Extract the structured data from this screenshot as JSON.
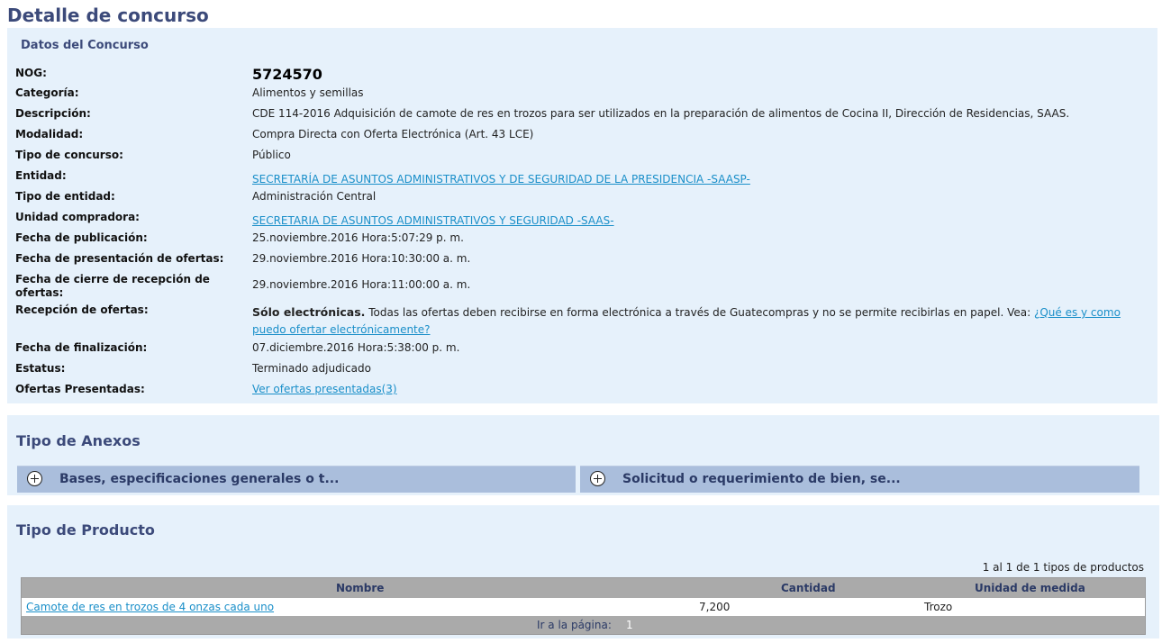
{
  "page": {
    "title": "Detalle de concurso"
  },
  "datos": {
    "section_title": "Datos del Concurso",
    "fields": {
      "nog": {
        "label": "NOG:",
        "value": "5724570"
      },
      "categoria": {
        "label": "Categoría:",
        "value": "Alimentos y semillas"
      },
      "descripcion": {
        "label": "Descripción:",
        "value": "CDE 114-2016 Adquisición de camote de res en trozos para ser utilizados en la preparación de alimentos de Cocina II, Dirección de Residencias, SAAS."
      },
      "modalidad": {
        "label": "Modalidad:",
        "value": "Compra Directa con Oferta Electrónica (Art. 43 LCE)"
      },
      "tipo_concurso": {
        "label": "Tipo de concurso:",
        "value": "Público"
      },
      "entidad": {
        "label": "Entidad:",
        "value": "SECRETARÍA DE ASUNTOS ADMINISTRATIVOS Y DE SEGURIDAD DE LA PRESIDENCIA -SAASP-"
      },
      "tipo_entidad": {
        "label": "Tipo de entidad:",
        "value": "Administración Central"
      },
      "unidad_compradora": {
        "label": "Unidad compradora:",
        "value": "SECRETARIA DE ASUNTOS ADMINISTRATIVOS Y SEGURIDAD -SAAS-"
      },
      "fecha_publicacion": {
        "label": "Fecha de publicación:",
        "value": "25.noviembre.2016 Hora:5:07:29 p. m."
      },
      "fecha_presentacion": {
        "label": "Fecha de presentación de ofertas:",
        "value": "29.noviembre.2016 Hora:10:30:00 a. m."
      },
      "fecha_cierre": {
        "label": "Fecha de cierre de recepción de ofertas:",
        "value": "29.noviembre.2016 Hora:11:00:00 a. m."
      },
      "recepcion": {
        "label": "Recepción de ofertas:",
        "bold": "Sólo electrónicas.",
        "text": " Todas las ofertas deben recibirse en forma electrónica a través de Guatecompras y no se permite recibirlas en papel. Vea: ",
        "link": "¿Qué es y como puedo ofertar electrónicamente?"
      },
      "fecha_finalizacion": {
        "label": "Fecha de finalización:",
        "value": "07.diciembre.2016 Hora:5:38:00 p. m."
      },
      "estatus": {
        "label": "Estatus:",
        "value": "Terminado adjudicado"
      },
      "ofertas": {
        "label": "Ofertas Presentadas:",
        "value": "Ver ofertas presentadas(3)"
      }
    }
  },
  "anexos": {
    "title": "Tipo de Anexos",
    "items": [
      {
        "label": "Bases, especificaciones generales o t..."
      },
      {
        "label": "Solicitud o requerimiento de bien, se..."
      }
    ]
  },
  "producto": {
    "title": "Tipo de Producto",
    "count": "1 al 1 de 1 tipos de productos",
    "columns": [
      "Nombre",
      "Cantidad",
      "Unidad de medida"
    ],
    "rows": [
      {
        "nombre": "Camote de res en trozos de 4 onzas cada uno",
        "cantidad": "7,200",
        "unidad": "Trozo"
      }
    ],
    "pager": {
      "label": "Ir a la página:",
      "page": "1"
    }
  }
}
